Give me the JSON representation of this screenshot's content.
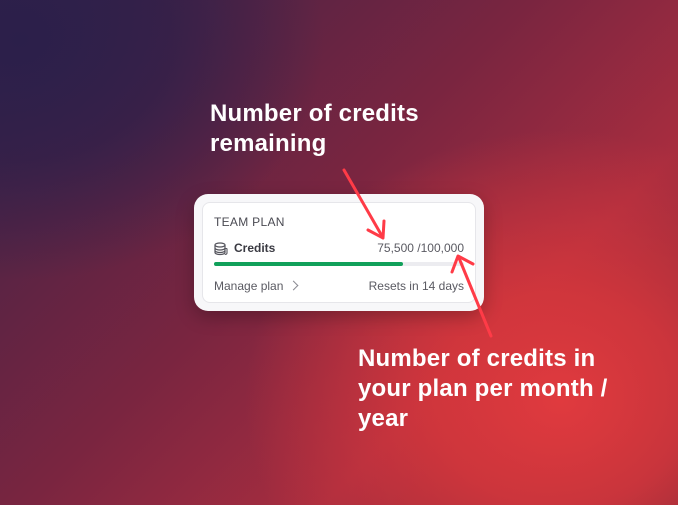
{
  "annotations": {
    "top_line1": "Number of credits",
    "top_line2": "remaining",
    "bottom_line1": "Number of credits in",
    "bottom_line2": "your plan per month /",
    "bottom_line3": "year"
  },
  "card": {
    "plan_title": "TEAM PLAN",
    "credits_label": "Credits",
    "credits_remaining": "75,500",
    "credits_separator": " /",
    "credits_total": "100,000",
    "progress_fraction": 0.755,
    "manage_label": "Manage plan",
    "reset_text": "Resets in 14 days"
  },
  "colors": {
    "progress": "#11a05a",
    "arrow": "#ff3b47"
  },
  "icons": {
    "credits": "coins-icon",
    "manage": "chevron-right-icon"
  }
}
